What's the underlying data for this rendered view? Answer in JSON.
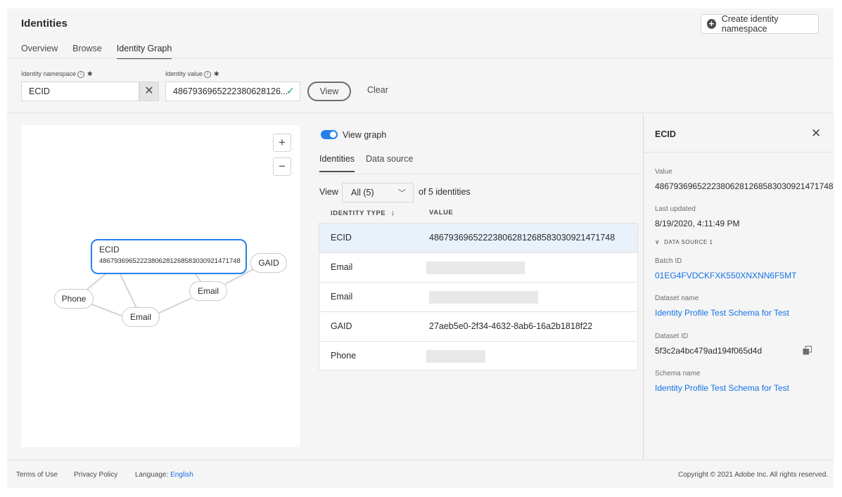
{
  "header": {
    "title": "Identities",
    "create_button": "Create identity namespace",
    "tabs": [
      {
        "label": "Overview"
      },
      {
        "label": "Browse"
      },
      {
        "label": "Identity Graph"
      }
    ]
  },
  "form": {
    "namespace_label": "Identity namespace",
    "namespace_value": "ECID",
    "value_label": "Identity value",
    "value_value": "486793696522238062812 6...",
    "value_display": "4867936965222380628126...",
    "view_button": "View",
    "clear_button": "Clear"
  },
  "graph": {
    "main_node_type": "ECID",
    "main_node_value": "48679369652223806281268583030921471748",
    "nodes": [
      "GAID",
      "Email",
      "Phone",
      "Email"
    ]
  },
  "list": {
    "toggle_label": "View graph",
    "toggle_on": true,
    "subtabs": [
      {
        "label": "Identities"
      },
      {
        "label": "Data source"
      }
    ],
    "view_label": "View",
    "picker_value": "All (5)",
    "count_label": "of 5 identities",
    "col_type": "IDENTITY TYPE",
    "col_value": "VALUE",
    "rows": [
      {
        "type": "ECID",
        "value": "48679369652223806281268583030921471748",
        "selected": true
      },
      {
        "type": "Email",
        "value": ""
      },
      {
        "type": "Email",
        "value": ""
      },
      {
        "type": "GAID",
        "value": "27aeb5e0-2f34-4632-8ab6-16a2b1818f22"
      },
      {
        "type": "Phone",
        "value": ""
      }
    ]
  },
  "details": {
    "title": "ECID",
    "value_label": "Value",
    "value": "48679369652223806281268583030921471748",
    "updated_label": "Last updated",
    "updated": "8/19/2020, 4:11:49 PM",
    "data_source_heading": "DATA SOURCE 1",
    "batch_label": "Batch ID",
    "batch": "01EG4FVDCKFXK550XNXNN6F5MT",
    "dataset_name_label": "Dataset name",
    "dataset_name": "Identity Profile Test Schema for Test",
    "dataset_id_label": "Dataset ID",
    "dataset_id": "5f3c2a4bc479ad194f065d4d",
    "schema_label": "Schema name",
    "schema": "Identity Profile Test Schema for Test"
  },
  "footer": {
    "terms": "Terms of Use",
    "privacy": "Privacy Policy",
    "language_label": "Language:",
    "language": "English",
    "copyright": "Copyright © 2021 Adobe Inc. All rights reserved."
  },
  "colors": {
    "accent": "#2680eb",
    "link": "#1473e6",
    "success": "#2d9d78"
  }
}
